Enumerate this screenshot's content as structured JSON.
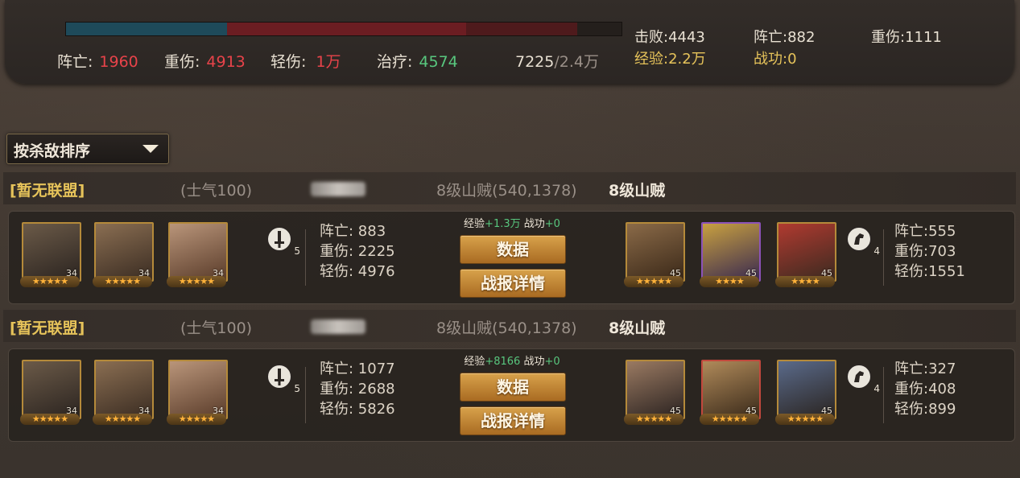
{
  "summary": {
    "dead_label": "阵亡:",
    "dead": "1960",
    "severe_label": "重伤:",
    "severe": "4913",
    "light_label": "轻伤:",
    "light": "1万",
    "heal_label": "治疗:",
    "heal": "4574",
    "troops_current": "7225",
    "troops_total": "/2.4万",
    "troop_bar": {
      "dead_fraction": 0.29,
      "severe_fraction": 0.43,
      "light_fraction": 0.2
    },
    "defeat": "击败:4443",
    "dead2": "阵亡:882",
    "severe2": "重伤:1111",
    "exp": "经验:2.2万",
    "merit": "战功:0"
  },
  "sort": {
    "label": "按杀敌排序"
  },
  "reports": [
    {
      "alliance": "[暂无联盟]",
      "morale": "(士气100)",
      "target": "8级山贼(540,1378)",
      "enemy_name": "8级山贼",
      "player_heroes": [
        {
          "level": "34",
          "stars": "★★★★★"
        },
        {
          "level": "34",
          "stars": "★★★★★"
        },
        {
          "level": "34",
          "stars": "★★★★★"
        }
      ],
      "player_tool_count": "5",
      "player_stats": {
        "dead": "阵亡: 883",
        "severe": "重伤: 2225",
        "light": "轻伤: 4976"
      },
      "reward_exp_label": "经验",
      "reward_exp": "+1.3万",
      "reward_merit_label": "战功",
      "reward_merit": "+0",
      "data_button": "数据",
      "detail_button": "战报详情",
      "enemy_heroes": [
        {
          "level": "45",
          "stars": "★★★★★"
        },
        {
          "level": "45",
          "stars": "★★★★"
        },
        {
          "level": "45",
          "stars": "★★★★"
        }
      ],
      "enemy_tool_count": "4",
      "enemy_stats": {
        "dead": "阵亡:555",
        "severe": "重伤:703",
        "light": "轻伤:1551"
      }
    },
    {
      "alliance": "[暂无联盟]",
      "morale": "(士气100)",
      "target": "8级山贼(540,1378)",
      "enemy_name": "8级山贼",
      "player_heroes": [
        {
          "level": "34",
          "stars": "★★★★★"
        },
        {
          "level": "34",
          "stars": "★★★★★"
        },
        {
          "level": "34",
          "stars": "★★★★★"
        }
      ],
      "player_tool_count": "5",
      "player_stats": {
        "dead": "阵亡: 1077",
        "severe": "重伤: 2688",
        "light": "轻伤: 5826"
      },
      "reward_exp_label": "经验",
      "reward_exp": "+8166",
      "reward_merit_label": "战功",
      "reward_merit": "+0",
      "data_button": "数据",
      "detail_button": "战报详情",
      "enemy_heroes": [
        {
          "level": "45",
          "stars": "★★★★★"
        },
        {
          "level": "45",
          "stars": "★★★★★"
        },
        {
          "level": "45",
          "stars": "★★★★★"
        }
      ],
      "enemy_tool_count": "4",
      "enemy_stats": {
        "dead": "阵亡:327",
        "severe": "重伤:408",
        "light": "轻伤:899"
      }
    }
  ]
}
